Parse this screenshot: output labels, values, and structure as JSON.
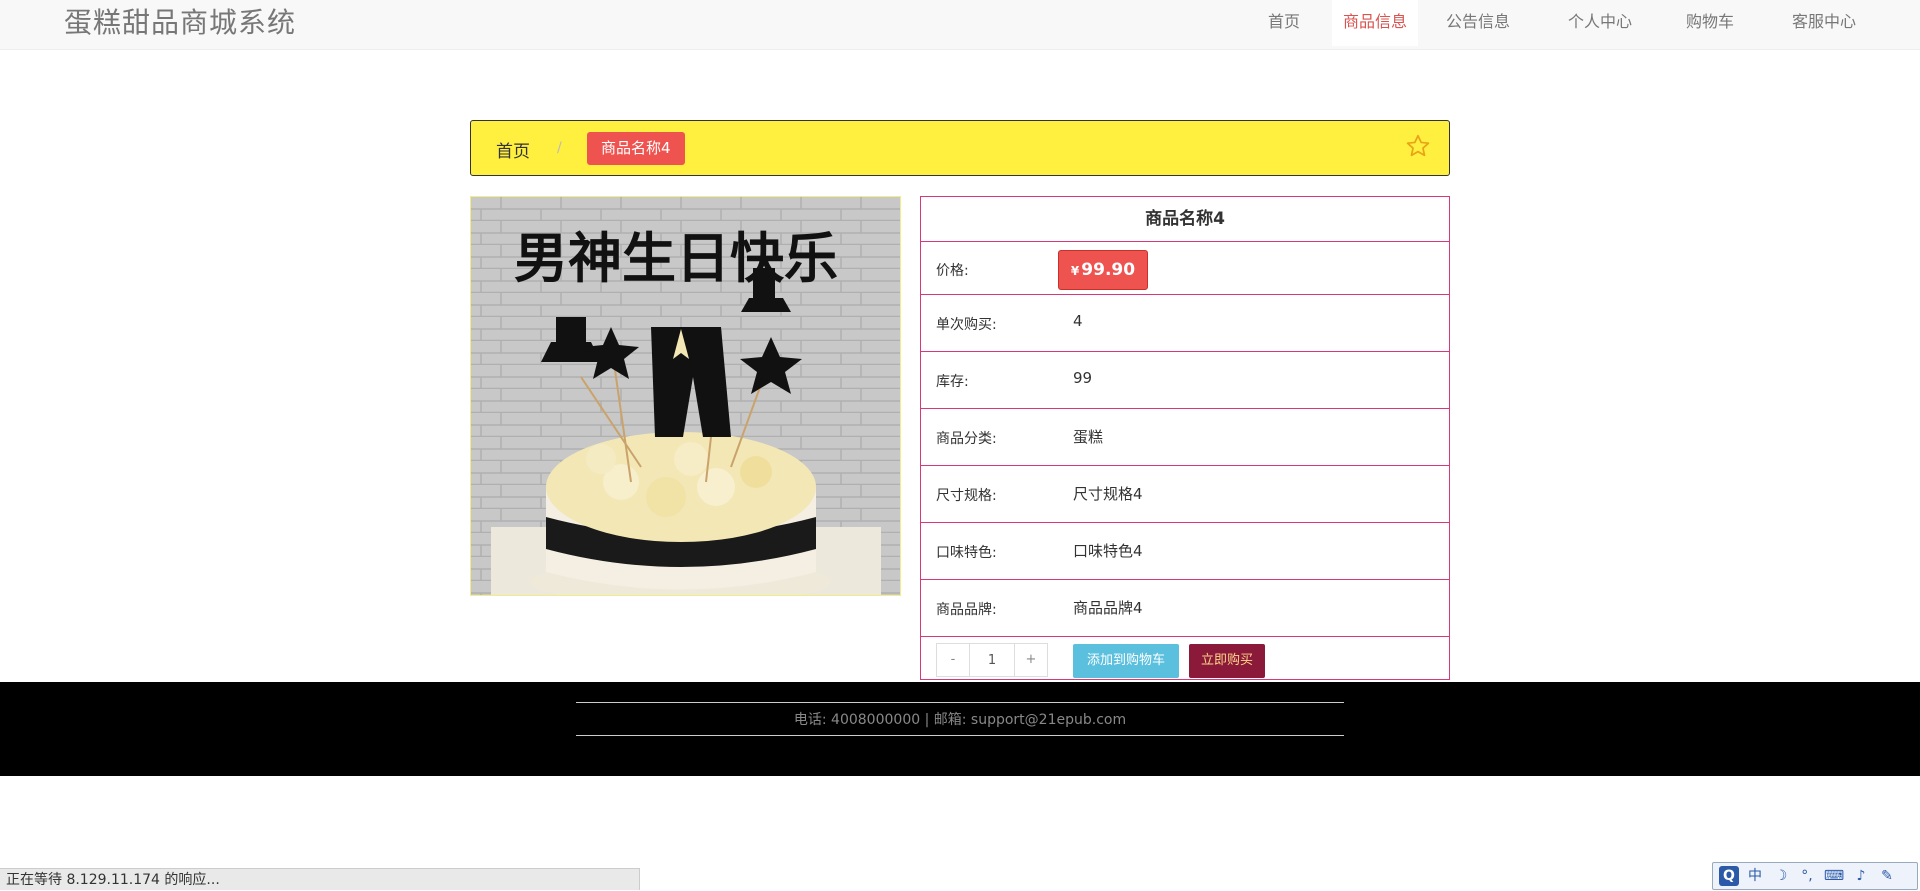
{
  "header": {
    "brand": "蛋糕甜品商城系统",
    "nav": [
      {
        "label": "首页",
        "active": false
      },
      {
        "label": "商品信息",
        "active": true
      },
      {
        "label": "公告信息",
        "active": false
      },
      {
        "label": "个人中心",
        "active": false
      },
      {
        "label": "购物车",
        "active": false
      },
      {
        "label": "客服中心",
        "active": false
      }
    ]
  },
  "breadcrumb": {
    "home": "首页",
    "separator": "/",
    "current": "商品名称4",
    "favorite_icon": "star-outline-icon"
  },
  "product": {
    "name": "商品名称4",
    "image_text": "男神生日快乐",
    "price_symbol": "¥",
    "price": "99.90",
    "fields": [
      {
        "label": "单次购买:",
        "value": "4"
      },
      {
        "label": "库存:",
        "value": "99"
      },
      {
        "label": "商品分类:",
        "value": "蛋糕"
      },
      {
        "label": "尺寸规格:",
        "value": "尺寸规格4"
      },
      {
        "label": "口味特色:",
        "value": "口味特色4"
      },
      {
        "label": "商品品牌:",
        "value": "商品品牌4"
      }
    ],
    "price_label": "价格:",
    "quantity": "1",
    "minus_label": "-",
    "plus_label": "+",
    "add_to_cart": "添加到购物车",
    "buy_now": "立即购买"
  },
  "footer": {
    "contact": "电话: 4008000000 | 邮箱: support@21epub.com"
  },
  "browser": {
    "status": "正在等待 8.129.11.174 的响应...",
    "ime": [
      "中",
      "☽",
      "°,",
      "⌨",
      "♪",
      "✎"
    ]
  },
  "colors": {
    "accent": "#d9534f",
    "breadcrumb_bg": "#ffef3f",
    "table_border": "#d8377a",
    "cart_button": "#5bc0de",
    "buy_button": "#8b1a3a",
    "footer_bg": "#000000"
  }
}
